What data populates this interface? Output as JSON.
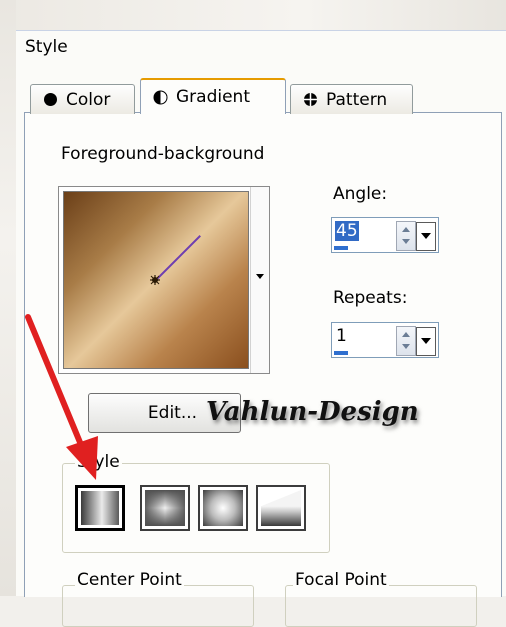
{
  "dialog": {
    "group_title": "Style",
    "tabs": [
      {
        "label": "Color"
      },
      {
        "label": "Gradient"
      },
      {
        "label": "Pattern"
      }
    ],
    "selected_tab": "Gradient",
    "gradient_name": "Foreground-background",
    "angle": {
      "label": "Angle:",
      "value": "45"
    },
    "repeats": {
      "label": "Repeats:",
      "value": "1"
    },
    "edit_label": "Edit...",
    "watermark": "Vahlun-Design",
    "style_group": {
      "label": "Style",
      "options": [
        "linear-icon",
        "rectangular-icon",
        "sunburst-icon",
        "radial-icon"
      ],
      "selected": "linear-icon"
    },
    "center_point_label": "Center Point",
    "focal_point_label": "Focal Point",
    "colors": {
      "gradient_dark": "#6b3f18",
      "gradient_light": "#e6c89a",
      "angle_line": "#6f3fb0",
      "active_tab_accent": "#e69b00",
      "annotation_arrow": "#e02020"
    }
  }
}
